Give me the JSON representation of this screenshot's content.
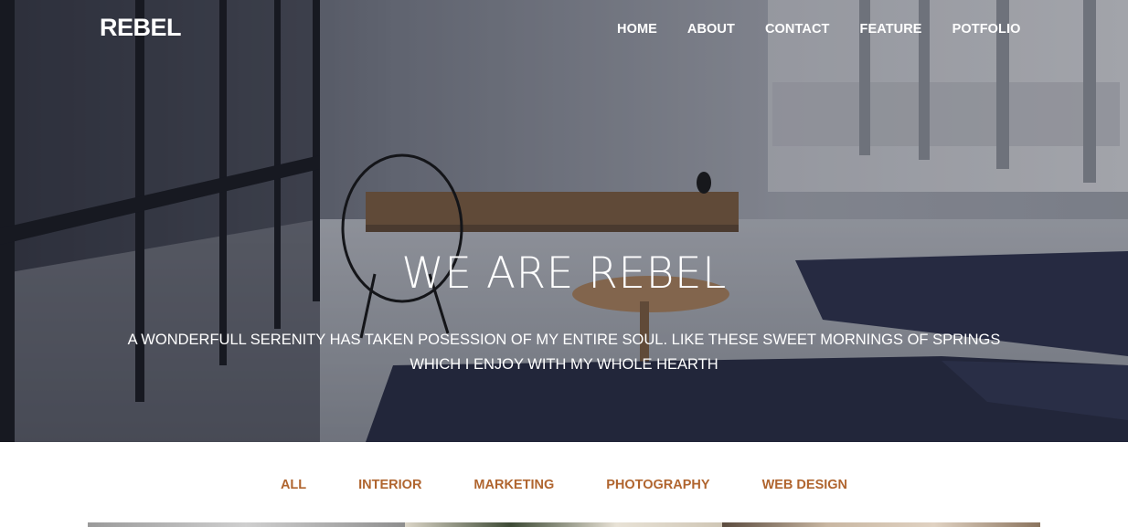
{
  "brand": {
    "logo": "REBEL"
  },
  "nav": {
    "items": [
      {
        "label": "HOME"
      },
      {
        "label": "ABOUT"
      },
      {
        "label": "CONTACT"
      },
      {
        "label": "FEATURE"
      },
      {
        "label": "POTFOLIO"
      }
    ]
  },
  "hero": {
    "title": "WE ARE REBEL",
    "subtitle": "A WONDERFULL SERENITY HAS TAKEN POSESSION OF MY ENTIRE SOUL. LIKE THESE SWEET MORNINGS OF SPRINGS WHICH I ENJOY WITH MY WHOLE HEARTH"
  },
  "filters": {
    "items": [
      {
        "label": "ALL"
      },
      {
        "label": "INTERIOR"
      },
      {
        "label": "MARKETING"
      },
      {
        "label": "PHOTOGRAPHY"
      },
      {
        "label": "WEB DESIGN"
      }
    ]
  },
  "colors": {
    "accent": "#b0652f",
    "nav_text": "#ffffff",
    "page_bg": "#ffffff"
  },
  "icons": {
    "logo": "text-logo"
  }
}
